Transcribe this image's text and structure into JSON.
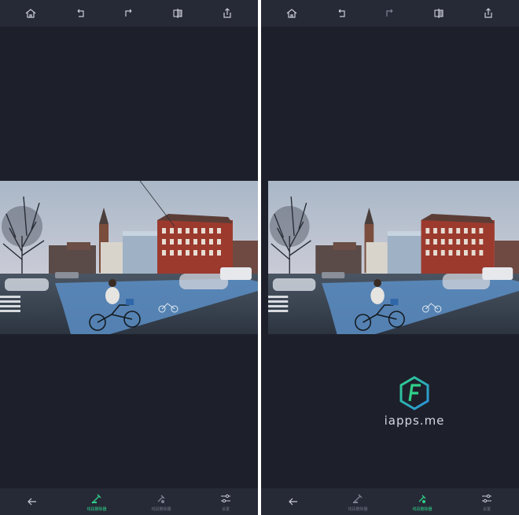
{
  "colors": {
    "background": "#1d202a",
    "bar": "#262a36",
    "icon": "#c9ccd6",
    "icon_dim": "#7e8392",
    "accent": "#2fd08a"
  },
  "screens": [
    {
      "toolbar": [
        "home-icon",
        "undo-icon",
        "redo-icon",
        "compare-icon",
        "share-icon"
      ],
      "bottom": [
        {
          "icon": "back-arrow-icon",
          "label": ""
        },
        {
          "icon": "brush-remove-icon",
          "label": "线段删除器",
          "active": true
        },
        {
          "icon": "touch-remove-icon",
          "label": "线段删除器",
          "active": false
        },
        {
          "icon": "settings-sliders-icon",
          "label": "设置",
          "active": false
        }
      ]
    },
    {
      "toolbar": [
        "home-icon",
        "undo-icon",
        "redo-icon",
        "compare-icon",
        "share-icon"
      ],
      "watermark": "iapps.me",
      "bottom": [
        {
          "icon": "back-arrow-icon",
          "label": ""
        },
        {
          "icon": "brush-remove-icon",
          "label": "线段删除器",
          "active": false
        },
        {
          "icon": "touch-remove-icon",
          "label": "线段删除器",
          "active": true
        },
        {
          "icon": "settings-sliders-icon",
          "label": "设置",
          "active": false
        }
      ]
    }
  ]
}
